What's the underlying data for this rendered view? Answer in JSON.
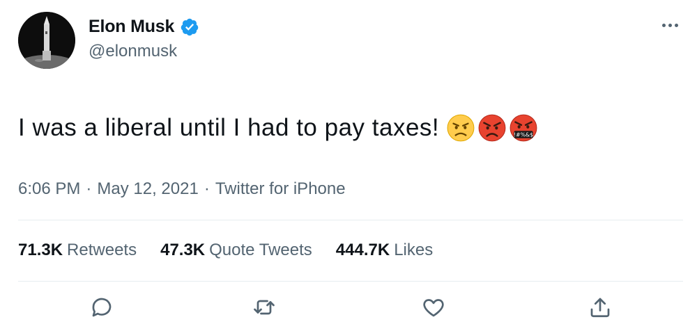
{
  "user": {
    "name": "Elon Musk",
    "handle": "@elonmusk",
    "verified": true
  },
  "tweet": {
    "text": "I was a liberal until I had to pay taxes!",
    "emojis": [
      "unamused-frown-face",
      "angry-red-face",
      "face-with-symbols-on-mouth"
    ],
    "symbols_text": "!#%&$"
  },
  "meta": {
    "time": "6:06 PM",
    "sep1": "·",
    "date": "May 12, 2021",
    "sep2": "·",
    "source": "Twitter for iPhone"
  },
  "stats": {
    "retweets_count": "71.3K",
    "retweets_label": "Retweets",
    "quotes_count": "47.3K",
    "quotes_label": "Quote Tweets",
    "likes_count": "444.7K",
    "likes_label": "Likes"
  },
  "actions": [
    "reply-icon",
    "retweet-icon",
    "like-icon",
    "share-icon"
  ],
  "colors": {
    "verified": "#1d9bf0",
    "secondary_text": "#536471",
    "primary_text": "#0f1419",
    "divider": "#e6ecf0"
  }
}
